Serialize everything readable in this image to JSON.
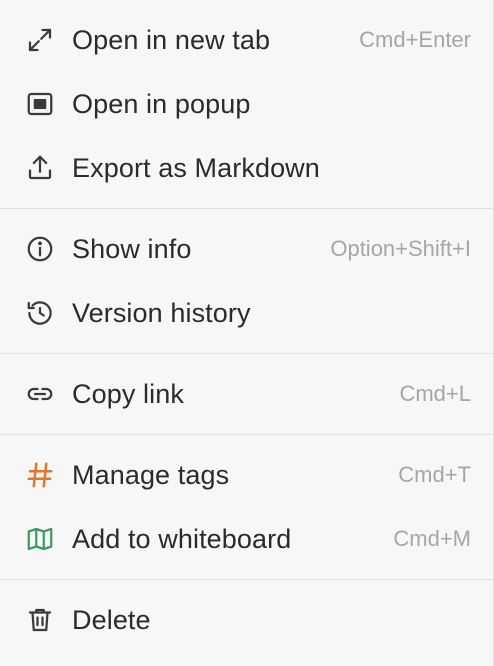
{
  "menu": {
    "groups": [
      {
        "items": [
          {
            "label": "Open in new tab",
            "shortcut": "Cmd+Enter",
            "icon": "expand-arrows-icon"
          },
          {
            "label": "Open in popup",
            "shortcut": "",
            "icon": "popup-window-icon"
          },
          {
            "label": "Export as Markdown",
            "shortcut": "",
            "icon": "export-upload-icon"
          }
        ]
      },
      {
        "items": [
          {
            "label": "Show info",
            "shortcut": "Option+Shift+I",
            "icon": "info-circle-icon"
          },
          {
            "label": "Version history",
            "shortcut": "",
            "icon": "history-clock-icon"
          }
        ]
      },
      {
        "items": [
          {
            "label": "Copy link",
            "shortcut": "Cmd+L",
            "icon": "link-icon"
          }
        ]
      },
      {
        "items": [
          {
            "label": "Manage tags",
            "shortcut": "Cmd+T",
            "icon": "hash-tag-icon"
          },
          {
            "label": "Add to whiteboard",
            "shortcut": "Cmd+M",
            "icon": "map-whiteboard-icon"
          }
        ]
      },
      {
        "items": [
          {
            "label": "Delete",
            "shortcut": "",
            "icon": "trash-icon"
          }
        ]
      }
    ]
  },
  "colors": {
    "background": "#f7f7f7",
    "text": "#2b2b2b",
    "shortcut": "#a6a6a6",
    "icon": "#3a3a3a",
    "tag_accent": "#e2762f",
    "whiteboard_accent": "#3f9a63"
  }
}
